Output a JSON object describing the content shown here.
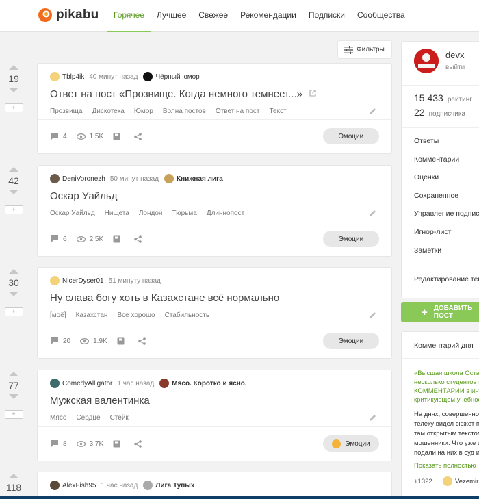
{
  "header": {
    "logo_text": "pikabu",
    "nav": [
      {
        "label": "Горячее",
        "active": true
      },
      {
        "label": "Лучшее"
      },
      {
        "label": "Свежее"
      },
      {
        "label": "Рекомендации"
      },
      {
        "label": "Подписки"
      },
      {
        "label": "Сообщества"
      }
    ]
  },
  "filters_label": "Фильтры",
  "posts": [
    {
      "votes": "19",
      "author": "Tblp4ik",
      "time": "40 минут назад",
      "community": "Чёрный юмор",
      "title": "Ответ на пост «Прозвище. Когда немного темнеет...»",
      "tags": [
        "Прозвища",
        "Дискотека",
        "Юмор",
        "Волна постов",
        "Ответ на пост",
        "Текст"
      ],
      "comments": "4",
      "views": "1.5K",
      "emotions_label": "Эмоции"
    },
    {
      "votes": "42",
      "author": "DeniVoronezh",
      "time": "50 минут назад",
      "community": "Книжная лига",
      "title": "Оскар Уайльд",
      "tags": [
        "Оскар Уайльд",
        "Нищета",
        "Лондон",
        "Тюрьма",
        "Длиннопост"
      ],
      "comments": "6",
      "views": "2.5K",
      "emotions_label": "Эмоции"
    },
    {
      "votes": "30",
      "author": "NicerDyser01",
      "time": "51 минуту назад",
      "community": "",
      "title": "Ну слава богу хоть в Казахстане всё нормально",
      "tags": [
        "[моё]",
        "Казахстан",
        "Все хорошо",
        "Стабильность"
      ],
      "comments": "20",
      "views": "1.9K",
      "emotions_label": "Эмоции"
    },
    {
      "votes": "77",
      "author": "ComedyAlligator",
      "time": "1 час назад",
      "community": "Мясо. Коротко и ясно.",
      "title": "Мужская валентинка",
      "tags": [
        "Мясо",
        "Сердце",
        "Стейк"
      ],
      "comments": "8",
      "views": "3.7K",
      "emotions_label": "Эмоции"
    },
    {
      "votes": "118",
      "author": "AlexFish95",
      "time": "1 час назад",
      "community": "Лига Тупых"
    }
  ],
  "sidebar": {
    "username": "devx",
    "logout": "выйти",
    "rating_value": "15 433",
    "rating_label": "рейтинг",
    "subscribers_value": "22",
    "subscribers_label": "подписчика",
    "menu": [
      "Ответы",
      "Комментарии",
      "Оценки",
      "Сохраненное",
      "Управление подписками",
      "Игнор-лист",
      "Заметки"
    ],
    "edit_themes": "Редактирование тем",
    "add_post": "ДОБАВИТЬ ПОСТ"
  },
  "comment_of_day": {
    "title": "Комментарий дня",
    "link": "«Высшая школа Остапа\nнесколько студентов и\nКОММЕНТАРИИ в интер\nкритикующем учебное",
    "text": "На днях, совершенно с\nтелеку видел сюжет пр\nтам открытым текстом\nмошенники. Что уже и\nподали на них в суд и т",
    "more": "Показать полностью",
    "score": "+1322",
    "author": "Vezemir"
  },
  "colors": {
    "accent": "#8ac858",
    "accent_text": "#5a9a21",
    "logo_orange": "#f26b1d"
  }
}
